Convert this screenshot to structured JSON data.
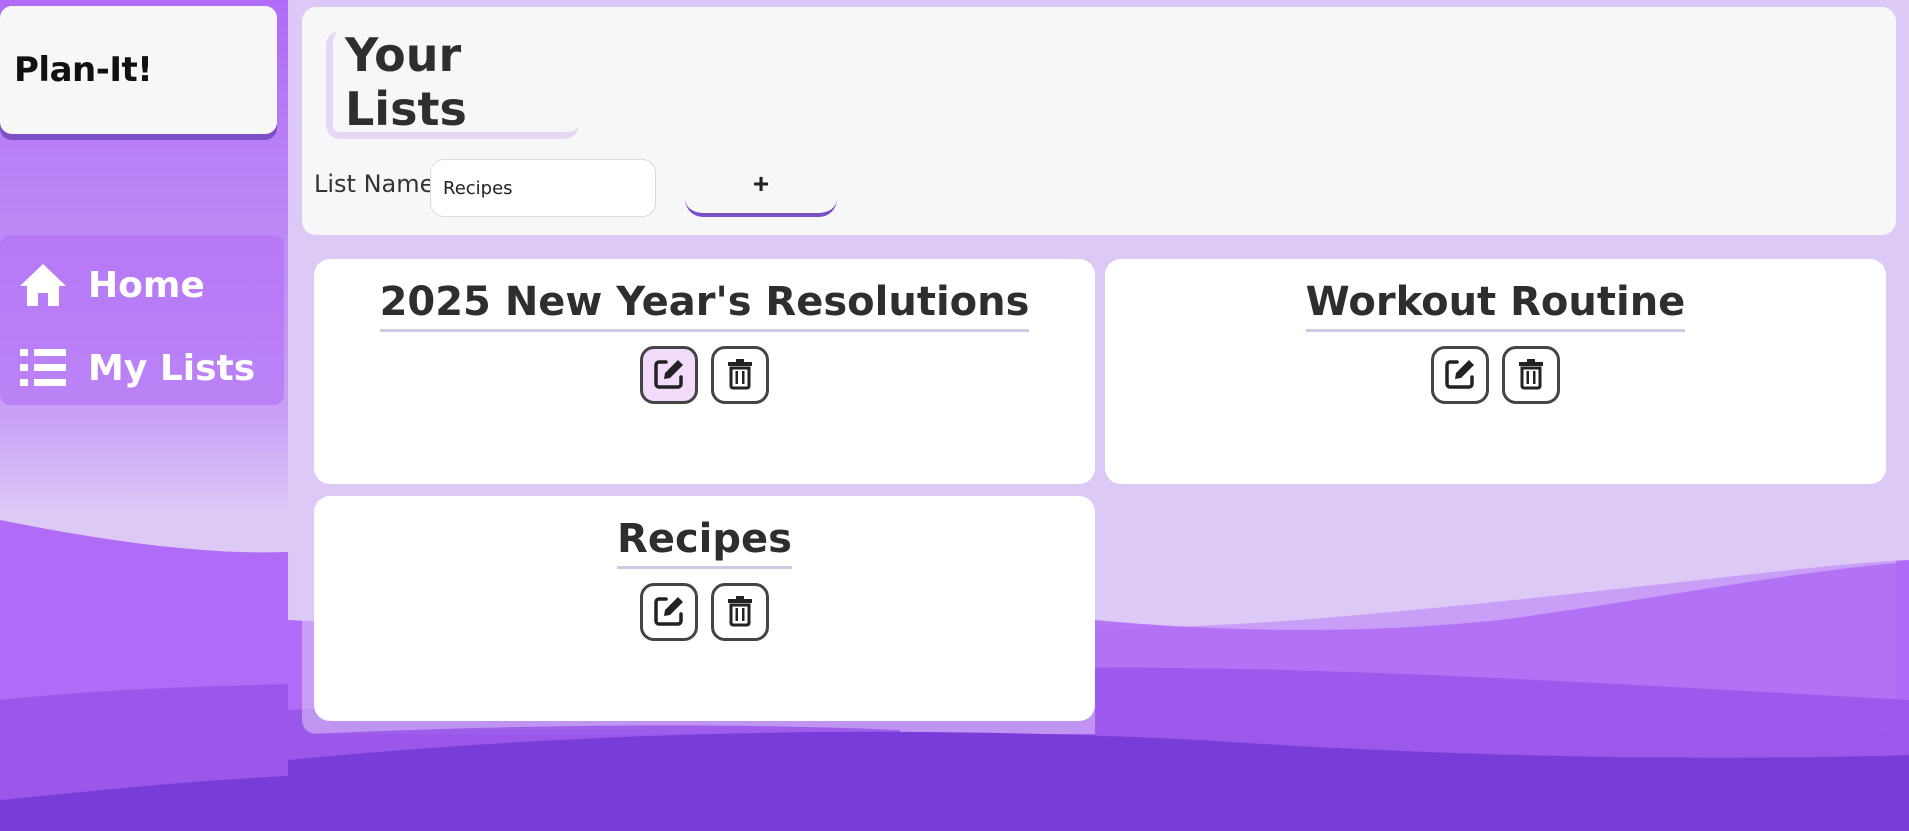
{
  "brand": {
    "name": "Plan-It!"
  },
  "sidebar": {
    "items": [
      {
        "label": "Home",
        "icon": "home-icon"
      },
      {
        "label": "My Lists",
        "icon": "list-icon"
      }
    ]
  },
  "header": {
    "title": "Your Lists",
    "list_name_label": "List Name",
    "list_name_value": "Recipes",
    "add_label": "+"
  },
  "lists": [
    {
      "title": "2025 New Year's Resolutions",
      "edit_icon": "edit-icon",
      "delete_icon": "trash-icon"
    },
    {
      "title": "Workout Routine",
      "edit_icon": "edit-icon",
      "delete_icon": "trash-icon"
    },
    {
      "title": "Recipes",
      "edit_icon": "edit-icon",
      "delete_icon": "trash-icon"
    }
  ],
  "colors": {
    "accent": "#7d4fc4",
    "sidebar": "#b06cf6",
    "panel": "#ddc9f6",
    "wave_dark": "#7a3cd9",
    "active_button": "#f3dcfb"
  }
}
